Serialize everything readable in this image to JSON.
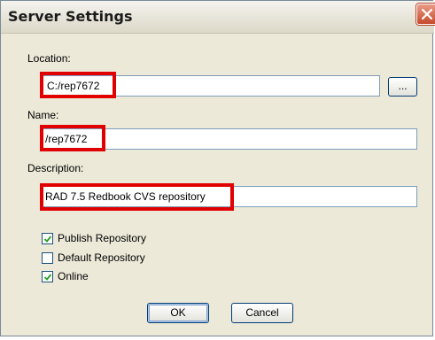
{
  "dialog": {
    "title": "Server Settings"
  },
  "location": {
    "label": "Location:",
    "value": "C:/rep7672",
    "browse_label": "..."
  },
  "name": {
    "label": "Name:",
    "value": "/rep7672"
  },
  "description": {
    "label": "Description:",
    "value": "RAD 7.5 Redbook CVS repository"
  },
  "options": [
    {
      "label": "Publish Repository",
      "checked": true
    },
    {
      "label": "Default Repository",
      "checked": false
    },
    {
      "label": "Online",
      "checked": true
    }
  ],
  "buttons": {
    "ok": "OK",
    "cancel": "Cancel"
  },
  "colors": {
    "highlight": "#e10000",
    "dialog_bg": "#ece9d8",
    "close_button": "#c54a2b"
  },
  "icons": {
    "close": "close-x-icon",
    "check": "checkmark-icon"
  }
}
